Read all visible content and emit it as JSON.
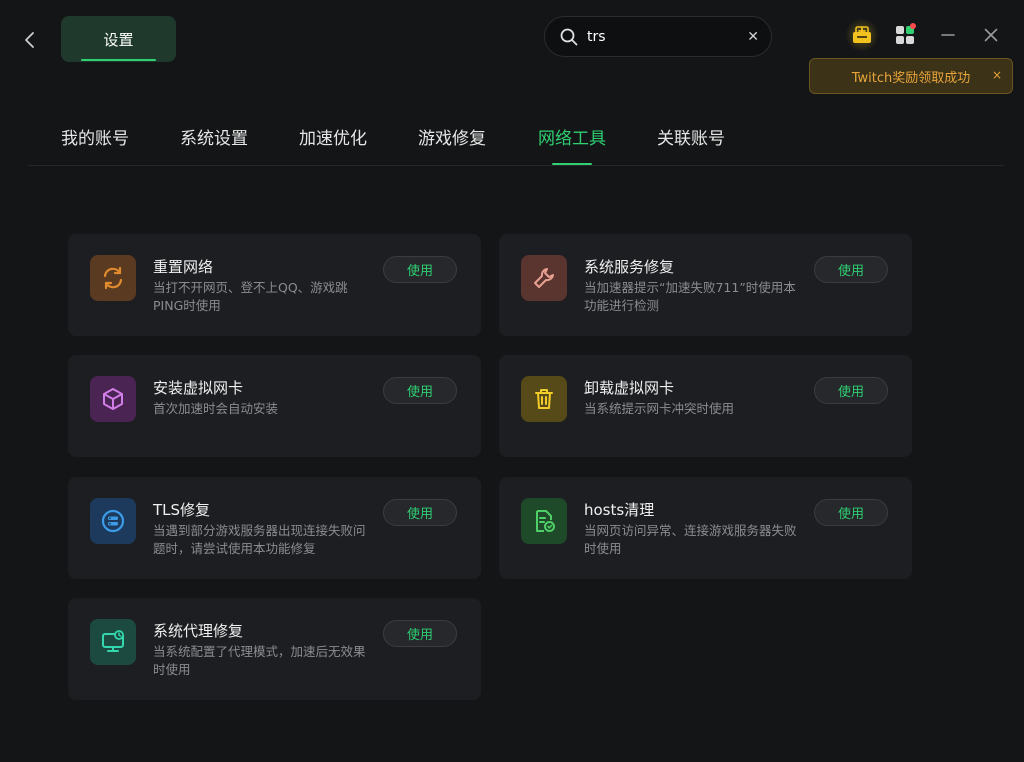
{
  "header": {
    "title": "设置",
    "search": {
      "value": "trs",
      "placeholder": ""
    },
    "icons": [
      "back-icon",
      "search-icon",
      "clear-icon",
      "gift-icon",
      "apps-icon",
      "minimize-icon",
      "close-icon"
    ]
  },
  "toast": {
    "text": "Twitch奖励领取成功",
    "close": "×"
  },
  "tabs": [
    {
      "label": "我的账号"
    },
    {
      "label": "系统设置"
    },
    {
      "label": "加速优化"
    },
    {
      "label": "游戏修复"
    },
    {
      "label": "网络工具",
      "active": true
    },
    {
      "label": "关联账号"
    }
  ],
  "tools": [
    {
      "name": "重置网络",
      "desc": "当打不开网页、登不上QQ、游戏跳PING时使用",
      "button": "使用",
      "icon": "refresh-icon",
      "color": "#e08a2e"
    },
    {
      "name": "系统服务修复",
      "desc": "当加速器提示“加速失败711”时使用本功能进行检测",
      "button": "使用",
      "icon": "wrench-icon",
      "color": "#e07b6a"
    },
    {
      "name": "安装虚拟网卡",
      "desc": "首次加速时会自动安装",
      "button": "使用",
      "icon": "cube-icon",
      "color": "#c46ee0"
    },
    {
      "name": "卸载虚拟网卡",
      "desc": "当系统提示网卡冲突时使用",
      "button": "使用",
      "icon": "trash-icon",
      "color": "#e6c22a"
    },
    {
      "name": "TLS修复",
      "desc": "当遇到部分游戏服务器出现连接失败问题时，请尝试使用本功能修复",
      "button": "使用",
      "icon": "server-icon",
      "color": "#3c8ee6"
    },
    {
      "name": "hosts清理",
      "desc": "当网页访问异常、连接游戏服务器失败时使用",
      "button": "使用",
      "icon": "file-clean-icon",
      "color": "#3fbf5c"
    },
    {
      "name": "系统代理修复",
      "desc": "当系统配置了代理模式，加速后无效果时使用",
      "button": "使用",
      "icon": "monitor-icon",
      "color": "#2fd0a8"
    }
  ]
}
